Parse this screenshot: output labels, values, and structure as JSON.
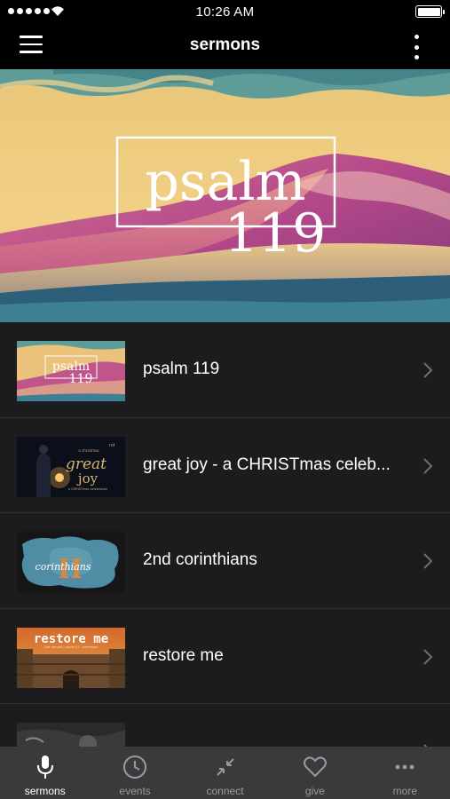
{
  "status_bar": {
    "time": "10:26 AM"
  },
  "nav": {
    "title": "sermons"
  },
  "hero": {
    "line1": "psalm",
    "line2": "119"
  },
  "series": [
    {
      "title": "psalm 119",
      "thumb": "psalm-119"
    },
    {
      "title": "great joy - a CHRISTmas celeb...",
      "thumb": "great-joy"
    },
    {
      "title": "2nd corinthians",
      "thumb": "2nd-corinthians"
    },
    {
      "title": "restore me",
      "thumb": "restore-me"
    },
    {
      "title": "",
      "thumb": "partial"
    }
  ],
  "thumbs": {
    "psalm": {
      "line1": "psalm",
      "line2": "119"
    },
    "joy": {
      "small": "a christmas",
      "line1": "great",
      "line2": "joy",
      "sub": "a CHRISTmas celebration",
      "mark": "nd"
    },
    "cor": {
      "word": "corinthians",
      "numeral": "II"
    },
    "restore": {
      "title": "restore me",
      "sub": "2nd samuel / psalm 51 / nehemiah"
    }
  },
  "tabs": [
    {
      "label": "sermons",
      "icon": "microphone-icon",
      "active": true
    },
    {
      "label": "events",
      "icon": "clock-icon",
      "active": false
    },
    {
      "label": "connect",
      "icon": "connect-arrows-icon",
      "active": false
    },
    {
      "label": "give",
      "icon": "heart-icon",
      "active": false
    },
    {
      "label": "more",
      "icon": "ellipsis-icon",
      "active": false
    }
  ],
  "colors": {
    "background": "#000000",
    "list_background": "#1c1c1e",
    "tab_bar": "#3a3a3c",
    "tab_inactive": "#9a9a9e",
    "chevron": "#6d6d72"
  }
}
